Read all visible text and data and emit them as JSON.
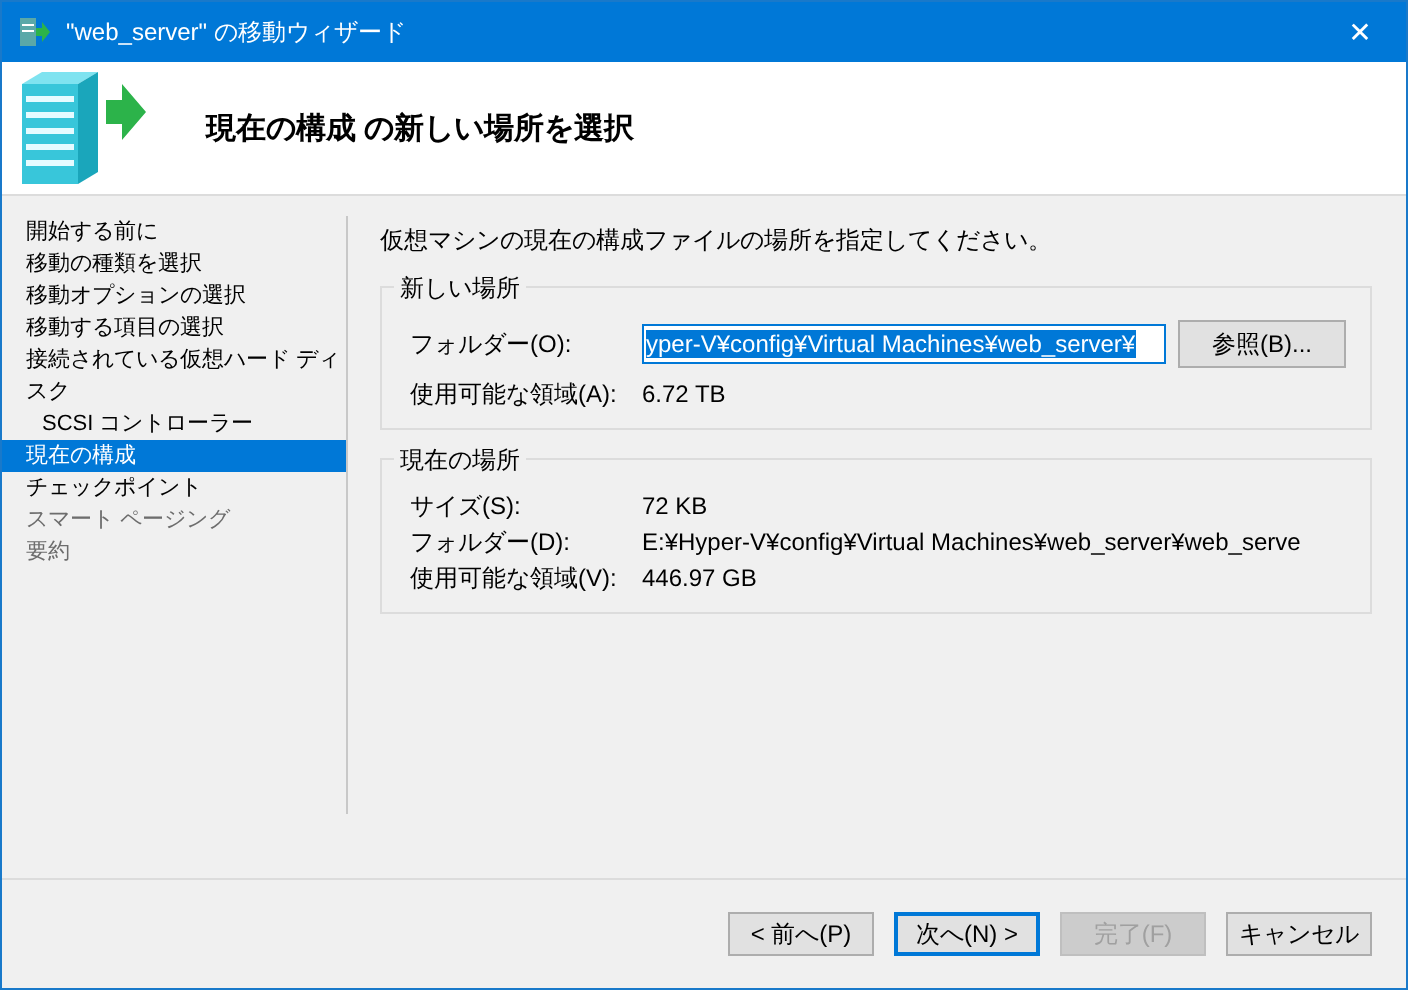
{
  "window": {
    "title": "\"web_server\" の移動ウィザード",
    "close": "✕"
  },
  "header": {
    "title": "現在の構成 の新しい場所を選択"
  },
  "steps": [
    {
      "label": "開始する前に",
      "selected": false,
      "disabled": false
    },
    {
      "label": "移動の種類を選択",
      "selected": false,
      "disabled": false
    },
    {
      "label": "移動オプションの選択",
      "selected": false,
      "disabled": false
    },
    {
      "label": "移動する項目の選択",
      "selected": false,
      "disabled": false
    },
    {
      "label": "接続されている仮想ハード ディスク",
      "selected": false,
      "disabled": false,
      "children": [
        {
          "label": "SCSI コントローラー",
          "selected": false,
          "disabled": false
        }
      ]
    },
    {
      "label": "現在の構成",
      "selected": true,
      "disabled": false
    },
    {
      "label": "チェックポイント",
      "selected": false,
      "disabled": false
    },
    {
      "label": "スマート ページング",
      "selected": false,
      "disabled": true
    },
    {
      "label": "要約",
      "selected": false,
      "disabled": true
    }
  ],
  "instruction": "仮想マシンの現在の構成ファイルの場所を指定してください。",
  "new_location": {
    "title": "新しい場所",
    "folder_label": "フォルダー(O):",
    "folder_value": "yper-V¥config¥Virtual Machines¥web_server¥",
    "folder_selected": true,
    "browse": "参照(B)...",
    "space_label": "使用可能な領域(A):",
    "space_value": "6.72 TB"
  },
  "current_location": {
    "title": "現在の場所",
    "rows": [
      {
        "label": "サイズ(S):",
        "value": "72 KB"
      },
      {
        "label": "フォルダー(D):",
        "value": "E:¥Hyper-V¥config¥Virtual Machines¥web_server¥web_serve"
      },
      {
        "label": "使用可能な領域(V):",
        "value": "446.97 GB"
      }
    ]
  },
  "buttons": [
    {
      "label": "< 前へ(P)",
      "disabled": false,
      "default": false
    },
    {
      "label": "次へ(N) >",
      "disabled": false,
      "default": true
    },
    {
      "label": "完了(F)",
      "disabled": true,
      "default": false
    },
    {
      "label": "キャンセル",
      "disabled": false,
      "default": false
    }
  ]
}
